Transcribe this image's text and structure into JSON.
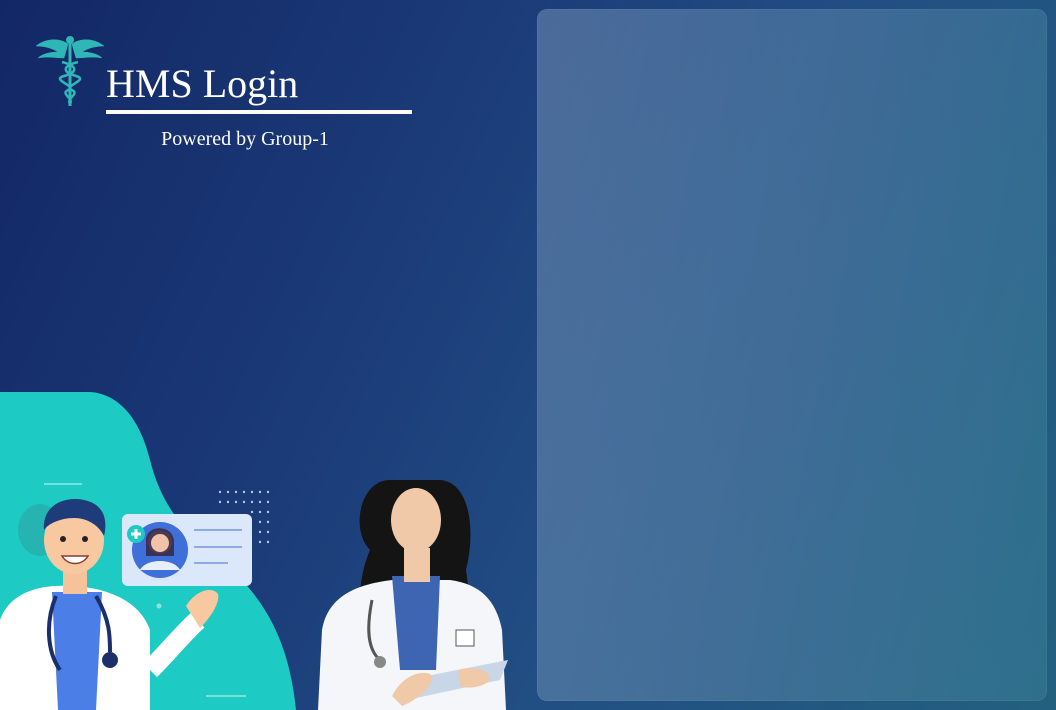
{
  "app": {
    "title": "HMS Login",
    "subtitle": "Powered by Group-1"
  },
  "icons": {
    "logo": "caduceus-icon"
  },
  "login_panel": {
    "state": "empty"
  },
  "colors": {
    "background_dark": "#132765",
    "background_light": "#23607f",
    "accent_teal": "#1ecbc4",
    "title_text": "#ffffff"
  }
}
